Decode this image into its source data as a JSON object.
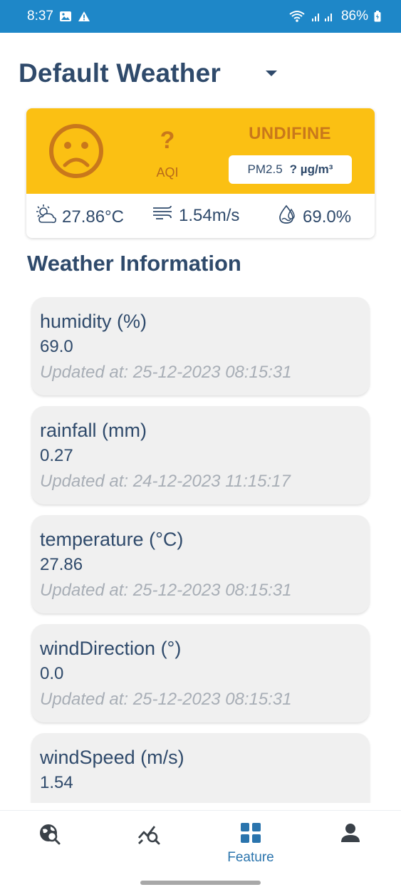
{
  "status_bar": {
    "time": "8:37",
    "battery": "86%",
    "icons": [
      "image-icon",
      "warning-icon",
      "wifi-icon",
      "signal-icon",
      "battery-icon"
    ]
  },
  "header": {
    "title": "Default Weather",
    "dropdown_icon": "caret-down-icon"
  },
  "aqi": {
    "value": "?",
    "label": "AQI",
    "status": "UNDIFINE",
    "pm_label": "PM2.5",
    "pm_value": "? µg/m³",
    "face_icon": "sad-face-icon",
    "colors": {
      "background": "#fbc013",
      "accent": "#c9781b"
    }
  },
  "current": {
    "temperature": "27.86°C",
    "wind": "1.54m/s",
    "humidity": "69.0%"
  },
  "section_title": "Weather Information",
  "cards": [
    {
      "title": "humidity (%)",
      "value": "69.0",
      "updated": "Updated at: 25-12-2023 08:15:31"
    },
    {
      "title": "rainfall (mm)",
      "value": "0.27",
      "updated": "Updated at: 24-12-2023 11:15:17"
    },
    {
      "title": "temperature (°C)",
      "value": "27.86",
      "updated": "Updated at: 25-12-2023 08:15:31"
    },
    {
      "title": "windDirection (°)",
      "value": "0.0",
      "updated": "Updated at: 25-12-2023 08:15:31"
    },
    {
      "title": "windSpeed (m/s)",
      "value": "1.54",
      "updated": ""
    }
  ],
  "nav": {
    "items": [
      {
        "icon": "globe-search-icon",
        "label": ""
      },
      {
        "icon": "chart-search-icon",
        "label": ""
      },
      {
        "icon": "grid-icon",
        "label": "Feature",
        "active": true
      },
      {
        "icon": "person-icon",
        "label": ""
      }
    ],
    "active_color": "#2a74ad"
  }
}
